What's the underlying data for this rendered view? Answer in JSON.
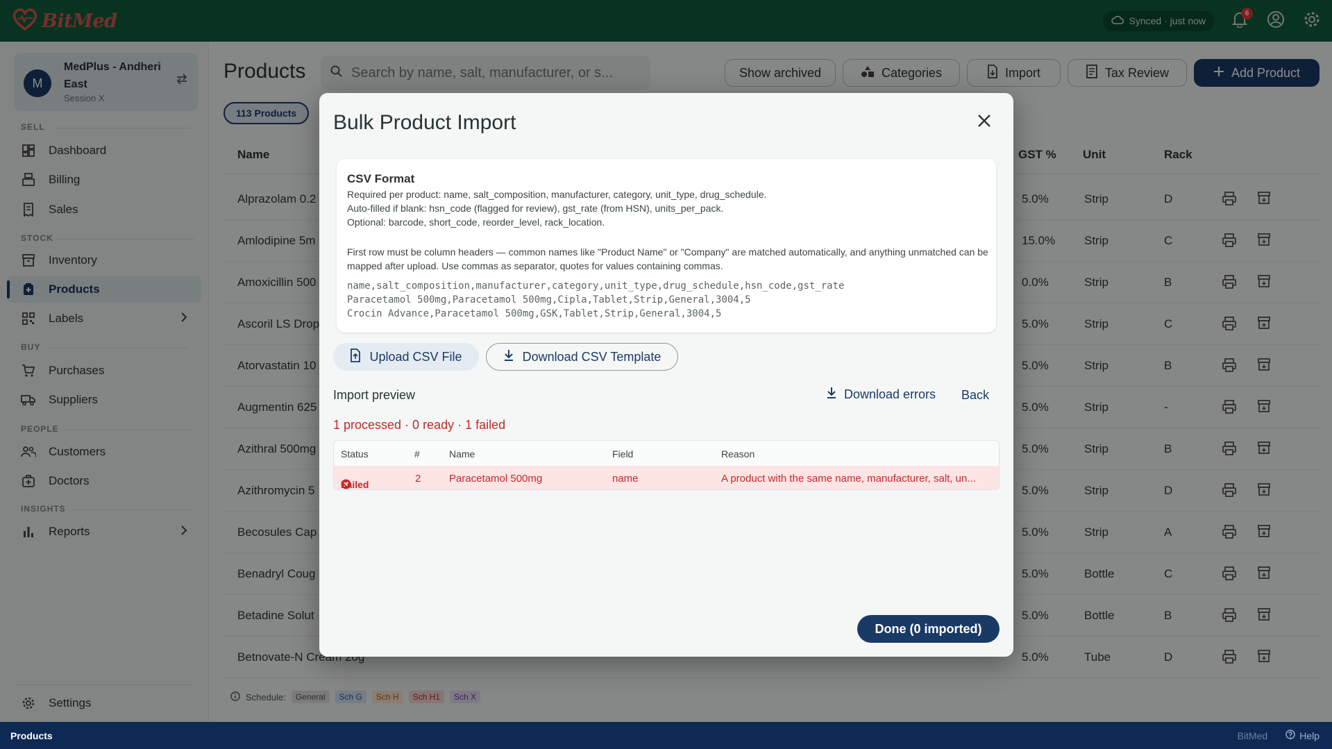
{
  "app": {
    "brand": "BitMed",
    "sync_status": "Synced · just now",
    "notification_count": "6"
  },
  "session": {
    "avatar_letter": "M",
    "store_name": "MedPlus - Andheri East",
    "session_label": "Session X"
  },
  "nav": {
    "sections": {
      "sell": "SELL",
      "stock": "STOCK",
      "buy": "BUY",
      "people": "PEOPLE",
      "insights": "INSIGHTS"
    },
    "items": {
      "dashboard": "Dashboard",
      "billing": "Billing",
      "sales": "Sales",
      "inventory": "Inventory",
      "products": "Products",
      "labels": "Labels",
      "purchases": "Purchases",
      "suppliers": "Suppliers",
      "customers": "Customers",
      "doctors": "Doctors",
      "reports": "Reports",
      "settings": "Settings"
    }
  },
  "page": {
    "title": "Products",
    "search_placeholder": "Search by name, salt, manufacturer, or s...",
    "buttons": {
      "show_archived": "Show archived",
      "categories": "Categories",
      "import": "Import",
      "tax_review": "Tax Review",
      "add_product": "Add Product"
    },
    "count_label": "113 Products",
    "columns": {
      "name": "Name",
      "gst": "GST %",
      "unit": "Unit",
      "rack": "Rack"
    },
    "rows": [
      {
        "name": "Alprazolam 0.2",
        "gst": "5.0%",
        "unit": "Strip",
        "rack": "D"
      },
      {
        "name": "Amlodipine 5m",
        "gst": "15.0%",
        "unit": "Strip",
        "rack": "C"
      },
      {
        "name": "Amoxicillin 500",
        "gst": "0.0%",
        "unit": "Strip",
        "rack": "B"
      },
      {
        "name": "Ascoril LS Drop",
        "gst": "5.0%",
        "unit": "Strip",
        "rack": "C"
      },
      {
        "name": "Atorvastatin 10",
        "gst": "5.0%",
        "unit": "Strip",
        "rack": "B"
      },
      {
        "name": "Augmentin 625",
        "gst": "5.0%",
        "unit": "Strip",
        "rack": "-"
      },
      {
        "name": "Azithral 500mg",
        "gst": "5.0%",
        "unit": "Strip",
        "rack": "B"
      },
      {
        "name": "Azithromycin 5",
        "gst": "5.0%",
        "unit": "Strip",
        "rack": "D"
      },
      {
        "name": "Becosules Cap",
        "gst": "5.0%",
        "unit": "Strip",
        "rack": "A"
      },
      {
        "name": "Benadryl Coug",
        "gst": "5.0%",
        "unit": "Bottle",
        "rack": "C"
      },
      {
        "name": "Betadine Solut",
        "gst": "5.0%",
        "unit": "Bottle",
        "rack": "B"
      },
      {
        "name": "Betnovate-N Cream 20g",
        "gst": "5.0%",
        "unit": "Tube",
        "rack": "D"
      }
    ],
    "schedule_legend": {
      "label": "Schedule:",
      "general": "General",
      "sch_g": "Sch G",
      "sch_h": "Sch H",
      "sch_h1": "Sch H1",
      "sch_x": "Sch X"
    }
  },
  "modal": {
    "title": "Bulk Product Import",
    "csv_format": {
      "title": "CSV Format",
      "required": "Required per product: name, salt_composition, manufacturer, category, unit_type, drug_schedule.",
      "autofilled": "Auto-filled if blank: hsn_code (flagged for review), gst_rate (from HSN), units_per_pack.",
      "optional": "Optional: barcode, short_code, reorder_level, rack_location.",
      "note": "First row must be column headers — common names like \"Product Name\" or \"Company\" are matched automatically, and anything unmatched can be mapped after upload. Use commas as separator, quotes for values containing commas.",
      "example_header": "name,salt_composition,manufacturer,category,unit_type,drug_schedule,hsn_code,gst_rate",
      "example_row_1": "Paracetamol 500mg,Paracetamol 500mg,Cipla,Tablet,Strip,General,3004,5",
      "example_row_2": "Crocin Advance,Paracetamol 500mg,GSK,Tablet,Strip,General,3004,5"
    },
    "upload_label": "Upload CSV File",
    "template_label": "Download CSV Template",
    "preview_label": "Import preview",
    "download_errors_label": "Download errors",
    "back_label": "Back",
    "summary": "1 processed · 0 ready · 1 failed",
    "table": {
      "headers": {
        "status": "Status",
        "num": "#",
        "name": "Name",
        "field": "Field",
        "reason": "Reason"
      },
      "rows": [
        {
          "status": "Failed",
          "num": "2",
          "name": "Paracetamol 500mg",
          "field": "name",
          "reason": "A product with the same name, manufacturer, salt, un..."
        }
      ]
    },
    "done_label": "Done (0 imported)"
  },
  "footer": {
    "left": "Products",
    "brand": "BitMed",
    "help": "Help"
  },
  "colors": {
    "topbar": "#0f5e3c",
    "primary": "#1a3a66",
    "error": "#c62828",
    "brand_red": "#d9574f"
  }
}
